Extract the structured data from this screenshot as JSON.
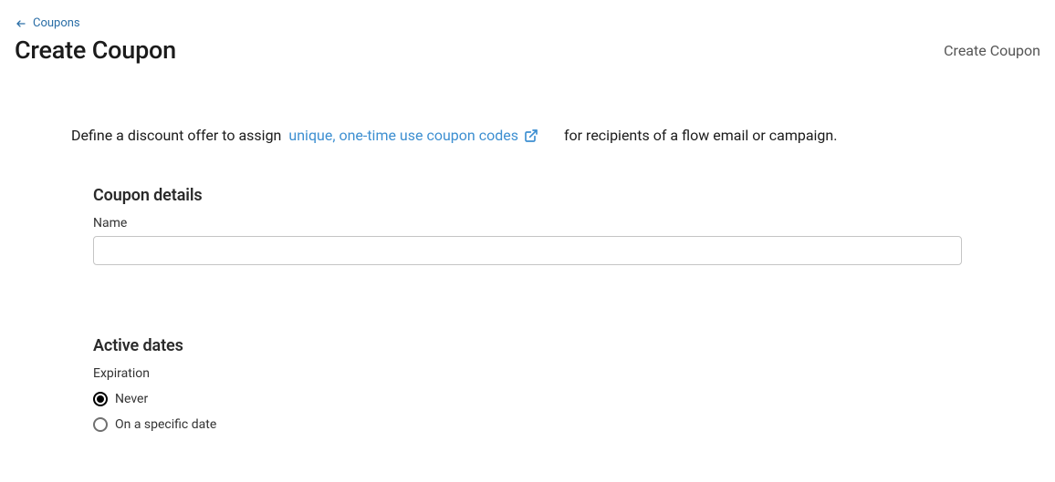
{
  "breadcrumb": {
    "label": "Coupons"
  },
  "header": {
    "title": "Create Coupon",
    "action": "Create Coupon"
  },
  "intro": {
    "prefix": "Define a discount offer to assign",
    "link_text": "unique, one-time use coupon codes",
    "suffix": "for recipients of a flow email or campaign."
  },
  "coupon_details": {
    "heading": "Coupon details",
    "name_label": "Name",
    "name_value": ""
  },
  "active_dates": {
    "heading": "Active dates",
    "expiration_label": "Expiration",
    "options": {
      "never": "Never",
      "specific": "On a specific date"
    },
    "selected": "never"
  }
}
